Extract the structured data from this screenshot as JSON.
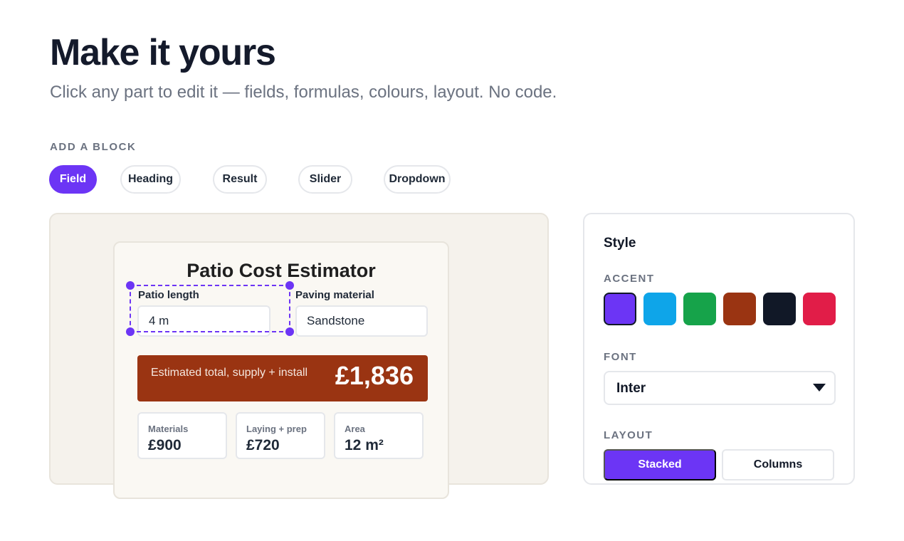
{
  "header": {
    "title": "Make it yours",
    "subtitle": "Click any part to edit it — fields, formulas, colours, layout. No code."
  },
  "add_block": {
    "label": "ADD A BLOCK",
    "chips": [
      "Field",
      "Heading",
      "Result",
      "Slider",
      "Dropdown"
    ],
    "active": "Field"
  },
  "preview": {
    "title": "Patio Cost Estimator",
    "fields": [
      {
        "label": "Patio length",
        "value": "4 m"
      },
      {
        "label": "Paving material",
        "value": "Sandstone"
      }
    ],
    "result": {
      "label": "Estimated total, supply + install",
      "value": "£1,836"
    },
    "stats": [
      {
        "label": "Materials",
        "value": "£900"
      },
      {
        "label": "Laying + prep",
        "value": "£720"
      },
      {
        "label": "Area",
        "value": "12 m²"
      }
    ],
    "accent_color": "#9a3412"
  },
  "style_panel": {
    "title": "Style",
    "accent_label": "ACCENT",
    "accent_colors": [
      "#6c35f5",
      "#0ea5e9",
      "#16a34a",
      "#9a3412",
      "#111827",
      "#e11d48"
    ],
    "selected_accent": "#6c35f5",
    "font_label": "FONT",
    "font_value": "Inter",
    "layout_label": "LAYOUT",
    "layout_options": [
      "Stacked",
      "Columns"
    ],
    "layout_selected": "Stacked"
  }
}
